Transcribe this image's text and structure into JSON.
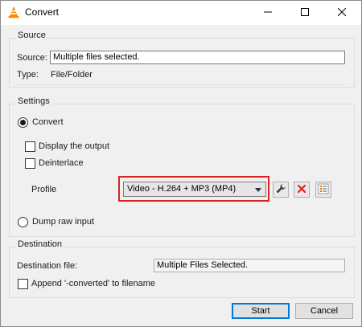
{
  "window": {
    "title": "Convert",
    "icon": "vlc-cone-icon"
  },
  "source": {
    "group_title": "Source",
    "source_label": "Source:",
    "source_value": "Multiple files selected.",
    "type_label": "Type:",
    "type_value": "File/Folder"
  },
  "settings": {
    "group_title": "Settings",
    "convert_label": "Convert",
    "convert_selected": true,
    "display_output_label": "Display the output",
    "display_output_checked": false,
    "deinterlace_label": "Deinterlace",
    "deinterlace_checked": false,
    "profile_label": "Profile",
    "profile_selected": "Video - H.264 + MP3 (MP4)",
    "dump_raw_label": "Dump raw input",
    "dump_raw_selected": false
  },
  "destination": {
    "group_title": "Destination",
    "file_label": "Destination file:",
    "file_value": "Multiple Files Selected.",
    "append_label": "Append '-converted' to filename",
    "append_checked": false
  },
  "buttons": {
    "start": "Start",
    "cancel": "Cancel"
  },
  "colors": {
    "highlight": "#d92323",
    "vlc_orange": "#ff8800",
    "delete_red": "#e02020",
    "default_button_border": "#0078d7"
  }
}
